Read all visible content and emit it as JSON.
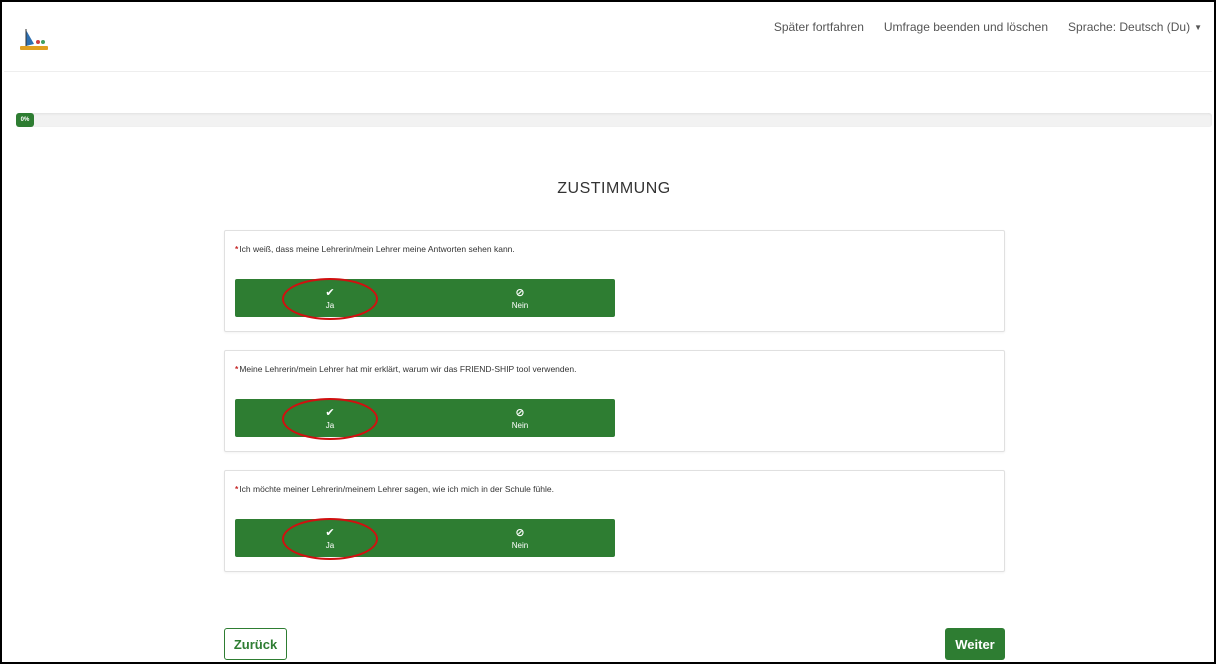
{
  "nav": {
    "links": [
      "Später fortfahren",
      "Umfrage beenden und löschen",
      "Sprache: Deutsch (Du)"
    ]
  },
  "progress": {
    "percent": 0,
    "label": "0%"
  },
  "page": {
    "title": "ZUSTIMMUNG"
  },
  "questions": [
    {
      "text": "Ich weiß, dass meine Lehrerin/mein Lehrer meine Antworten sehen kann.",
      "yes": "Ja",
      "no": "Nein"
    },
    {
      "text": "Meine Lehrerin/mein Lehrer hat mir erklärt, warum wir das FRIEND-SHIP tool verwenden.",
      "yes": "Ja",
      "no": "Nein"
    },
    {
      "text": "Ich möchte meiner Lehrerin/meinem Lehrer sagen, wie ich mich in der Schule fühle.",
      "yes": "Ja",
      "no": "Nein"
    }
  ],
  "footer": {
    "back": "Zurück",
    "next": "Weiter"
  },
  "colors": {
    "accent": "#2e7d32",
    "required": "#c62828",
    "highlight": "#d01010"
  }
}
